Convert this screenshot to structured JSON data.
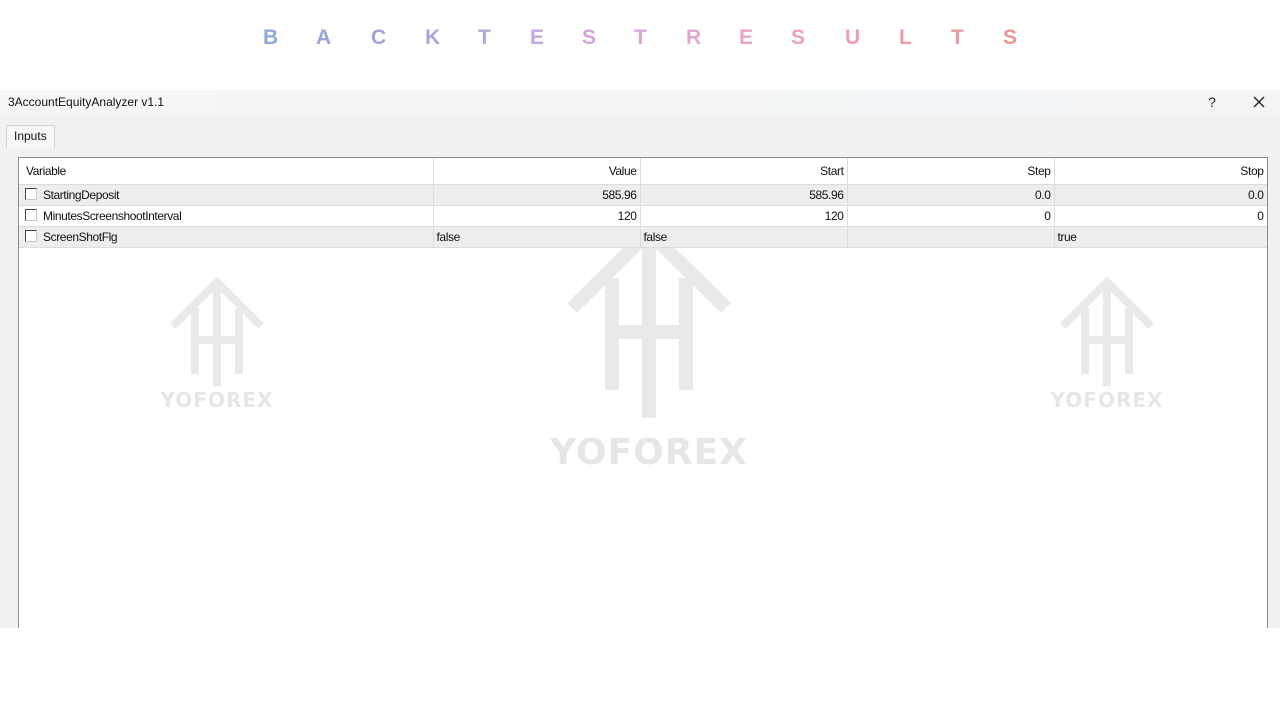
{
  "banner": {
    "letters": [
      "B",
      "A",
      "C",
      "K",
      "T",
      "E",
      "S",
      "T",
      "R",
      "E",
      "S",
      "U",
      "L",
      "T",
      "S"
    ],
    "colors": [
      "#8fa8d6",
      "#99a4d8",
      "#a1a3da",
      "#aaa4dc",
      "#b6a6dc",
      "#c4a8dc",
      "#d1a7da",
      "#dba6d8",
      "#e5a4d2",
      "#eaa3c8",
      "#eba2bd",
      "#ec9fb3",
      "#ec9ca8",
      "#ec98a0",
      "#ec9596"
    ]
  },
  "window": {
    "title": "3AccountEquityAnalyzer v1.1",
    "help_label": "?",
    "close_icon": "close-icon"
  },
  "tabs": [
    {
      "label": "Inputs",
      "active": true
    }
  ],
  "table": {
    "columns": [
      "Variable",
      "Value",
      "Start",
      "Step",
      "Stop"
    ],
    "rows": [
      {
        "variable": "StartingDeposit",
        "value": "585.96",
        "start": "585.96",
        "step": "0.0",
        "stop": "0.0",
        "checked": false
      },
      {
        "variable": "MinutesScreenshootInterval",
        "value": "120",
        "start": "120",
        "step": "0",
        "stop": "0",
        "checked": false
      },
      {
        "variable": "ScreenShotFlg",
        "value": "false",
        "start": "false",
        "step": "",
        "stop": "true",
        "checked": false
      }
    ]
  },
  "watermark": {
    "text": "YOFOREX",
    "logo_icon": "yoforex-logo-icon"
  }
}
